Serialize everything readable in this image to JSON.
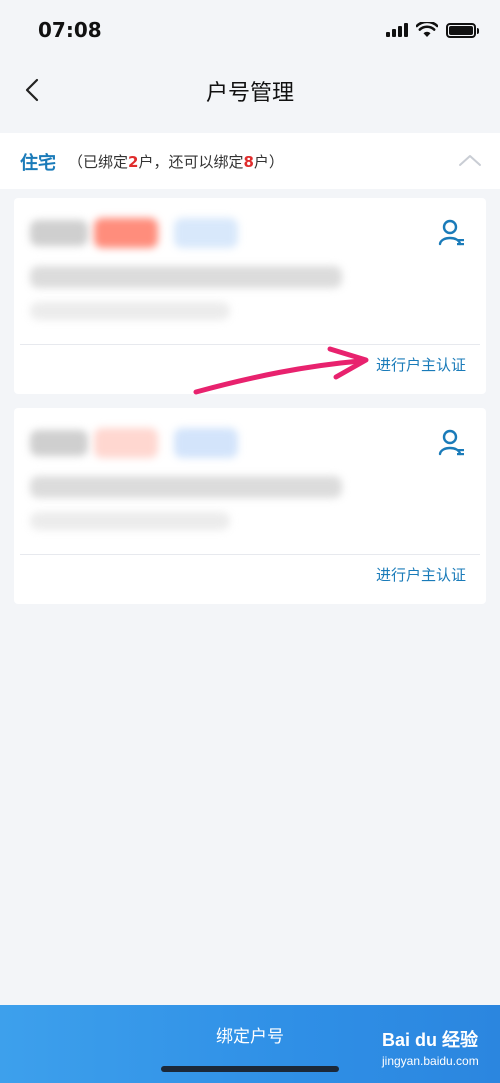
{
  "status_bar": {
    "time": "07:08"
  },
  "nav": {
    "title": "户号管理"
  },
  "section": {
    "title": "住宅",
    "sub_prefix": "（已绑定",
    "bound_count": "2",
    "sub_middle": "户，还可以绑定",
    "remaining_count": "8",
    "sub_suffix": "户）"
  },
  "cards": [
    {
      "verify_label": "进行户主认证"
    },
    {
      "verify_label": "进行户主认证"
    }
  ],
  "bottom": {
    "bind_label": "绑定户号"
  },
  "watermark": {
    "brand": "Bai du 经验",
    "url": "jingyan.baidu.com"
  },
  "colors": {
    "accent": "#1a7bb9",
    "highlight": "#e02d2d",
    "button": "#2f8fe6",
    "annotation": "#e8226e"
  }
}
